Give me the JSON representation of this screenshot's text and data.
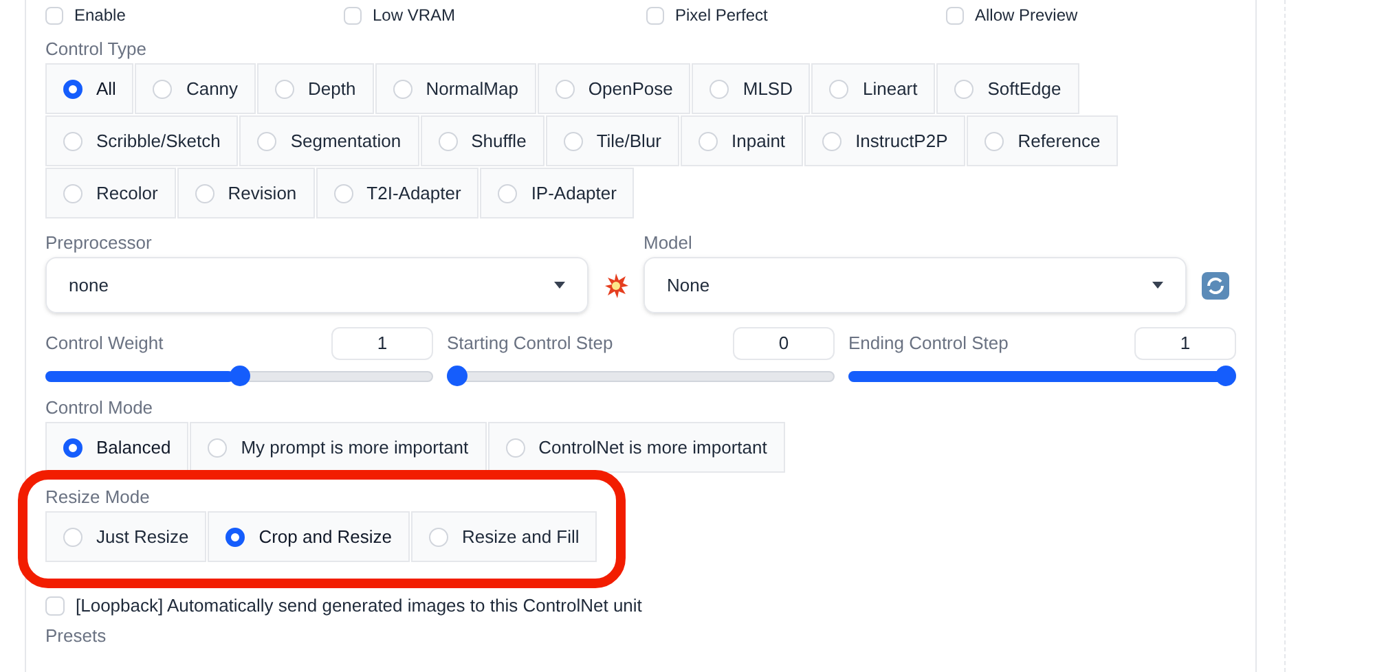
{
  "top_checkboxes": [
    {
      "label": "Enable",
      "checked": false
    },
    {
      "label": "Low VRAM",
      "checked": false
    },
    {
      "label": "Pixel Perfect",
      "checked": false
    },
    {
      "label": "Allow Preview",
      "checked": false
    }
  ],
  "control_type": {
    "label": "Control Type",
    "options": [
      {
        "label": "All",
        "selected": true
      },
      {
        "label": "Canny",
        "selected": false
      },
      {
        "label": "Depth",
        "selected": false
      },
      {
        "label": "NormalMap",
        "selected": false
      },
      {
        "label": "OpenPose",
        "selected": false
      },
      {
        "label": "MLSD",
        "selected": false
      },
      {
        "label": "Lineart",
        "selected": false
      },
      {
        "label": "SoftEdge",
        "selected": false
      },
      {
        "label": "Scribble/Sketch",
        "selected": false
      },
      {
        "label": "Segmentation",
        "selected": false
      },
      {
        "label": "Shuffle",
        "selected": false
      },
      {
        "label": "Tile/Blur",
        "selected": false
      },
      {
        "label": "Inpaint",
        "selected": false
      },
      {
        "label": "InstructP2P",
        "selected": false
      },
      {
        "label": "Reference",
        "selected": false
      },
      {
        "label": "Recolor",
        "selected": false
      },
      {
        "label": "Revision",
        "selected": false
      },
      {
        "label": "T2I-Adapter",
        "selected": false
      },
      {
        "label": "IP-Adapter",
        "selected": false
      }
    ]
  },
  "preprocessor": {
    "label": "Preprocessor",
    "value": "none"
  },
  "model": {
    "label": "Model",
    "value": "None"
  },
  "sliders": [
    {
      "label": "Control Weight",
      "value": "1",
      "level": 0.5
    },
    {
      "label": "Starting Control Step",
      "value": "0",
      "level": 0
    },
    {
      "label": "Ending Control Step",
      "value": "1",
      "level": 1
    }
  ],
  "control_mode": {
    "label": "Control Mode",
    "options": [
      {
        "label": "Balanced",
        "selected": true
      },
      {
        "label": "My prompt is more important",
        "selected": false
      },
      {
        "label": "ControlNet is more important",
        "selected": false
      }
    ]
  },
  "resize_mode": {
    "label": "Resize Mode",
    "highlighted": true,
    "options": [
      {
        "label": "Just Resize",
        "selected": false
      },
      {
        "label": "Crop and Resize",
        "selected": true
      },
      {
        "label": "Resize and Fill",
        "selected": false
      }
    ]
  },
  "loopback": {
    "label": "[Loopback] Automatically send generated images to this ControlNet unit",
    "checked": false
  },
  "presets": {
    "label": "Presets"
  }
}
